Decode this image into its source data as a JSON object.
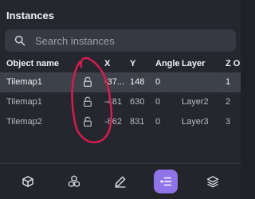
{
  "panel": {
    "title": "Instances"
  },
  "search": {
    "placeholder": "Search instances",
    "value": ""
  },
  "table": {
    "headers": {
      "name": "Object name",
      "x": "X",
      "y": "Y",
      "angle": "Angle",
      "layer": "Layer",
      "z": "Z O..."
    },
    "rows": [
      {
        "name": "Tilemap1",
        "x": "-37...",
        "y": "148",
        "angle": "0",
        "layer": "",
        "z": "1",
        "locked": false
      },
      {
        "name": "Tilemap1",
        "x": "-481",
        "y": "630",
        "angle": "0",
        "layer": "Layer2",
        "z": "2",
        "locked": false
      },
      {
        "name": "Tilemap2",
        "x": "-862",
        "y": "831",
        "angle": "0",
        "layer": "Layer3",
        "z": "3",
        "locked": false
      }
    ]
  },
  "toolbar": {
    "items": [
      {
        "icon": "cube-icon",
        "active": false
      },
      {
        "icon": "cubes-icon",
        "active": false
      },
      {
        "icon": "pencil-icon",
        "active": false
      },
      {
        "icon": "instances-list-icon",
        "active": true
      },
      {
        "icon": "layers-icon",
        "active": false
      }
    ]
  },
  "colors": {
    "background": "#25272e",
    "selected_row": "#3d4149",
    "accent": "#8f73e8",
    "annotation": "#e0194d"
  }
}
